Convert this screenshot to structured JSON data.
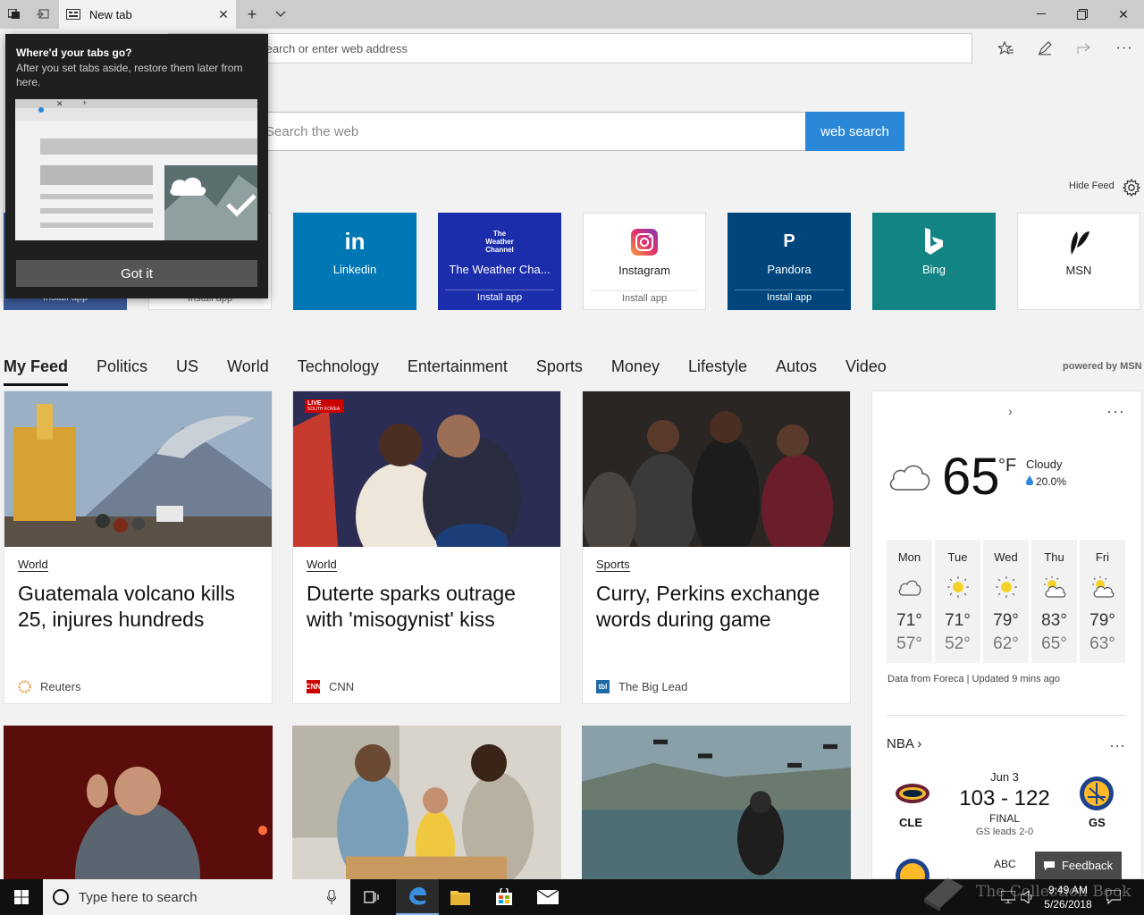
{
  "browser": {
    "tab_title": "New tab",
    "address_placeholder": "Search or enter web address"
  },
  "search": {
    "placeholder": "Search the web",
    "button_label": "web search"
  },
  "hide_feed_label": "Hide Feed",
  "tiles": [
    {
      "label": "",
      "install": "Install app",
      "color": "#3b5998"
    },
    {
      "label": "",
      "install": "Install app",
      "color": "#ffffff"
    },
    {
      "label": "Linkedin",
      "install": "",
      "color": "#0077b5",
      "icon_text": "in"
    },
    {
      "label": "The Weather Cha...",
      "install": "Install app",
      "color": "#1b2dab",
      "icon_text": "The Weather Channel"
    },
    {
      "label": "Instagram",
      "install": "Install app",
      "color": "#ffffff"
    },
    {
      "label": "Pandora",
      "install": "Install app",
      "color": "#00457c",
      "icon_text": "P"
    },
    {
      "label": "Bing",
      "install": "",
      "color": "#138484"
    },
    {
      "label": "MSN",
      "install": "",
      "color": "#ffffff"
    }
  ],
  "feed_nav": [
    "My Feed",
    "Politics",
    "US",
    "World",
    "Technology",
    "Entertainment",
    "Sports",
    "Money",
    "Lifestyle",
    "Autos",
    "Video"
  ],
  "powered_by": "powered by MSN",
  "cards": [
    {
      "category": "World",
      "title": "Guatemala volcano kills 25, injures hundreds",
      "source": "Reuters",
      "source_color": "#f08a24"
    },
    {
      "category": "World",
      "title": "Duterte sparks outrage with 'misogynist' kiss",
      "source": "CNN",
      "source_color": "#cc0000"
    },
    {
      "category": "Sports",
      "title": "Curry, Perkins exchange words during game",
      "source": "The Big Lead",
      "source_color": "#1d6aa5"
    }
  ],
  "card_overlays": {
    "live_badge": "LIVE",
    "badge_sub": "SOUTH KOREA"
  },
  "weather": {
    "temp": "65",
    "unit": "°F",
    "condition": "Cloudy",
    "precip": "20.0%",
    "forecast": [
      {
        "day": "Mon",
        "hi": "71°",
        "lo": "57°",
        "icon": "cloudy-icon"
      },
      {
        "day": "Tue",
        "hi": "71°",
        "lo": "52°",
        "icon": "sunny-icon"
      },
      {
        "day": "Wed",
        "hi": "79°",
        "lo": "62°",
        "icon": "sunny-icon"
      },
      {
        "day": "Thu",
        "hi": "83°",
        "lo": "65°",
        "icon": "partly-cloudy-icon"
      },
      {
        "day": "Fri",
        "hi": "79°",
        "lo": "63°",
        "icon": "partly-cloudy-icon"
      }
    ],
    "credit": "Data from Foreca | Updated 9 mins ago"
  },
  "nba": {
    "label": "NBA",
    "date": "Jun 3",
    "score": "103 - 122",
    "status": "FINAL",
    "note": "GS leads 2-0",
    "home_abbr": "CLE",
    "away_abbr": "GS",
    "next_label": "ABC"
  },
  "feedback_label": "Feedback",
  "popup": {
    "title": "Where'd your tabs go?",
    "body": "After you set tabs aside, restore them later from here.",
    "button": "Got it"
  },
  "taskbar": {
    "search_placeholder": "Type here to search",
    "time": "9:49 AM",
    "date": "5/26/2018"
  },
  "watermark": "The Collection Book"
}
